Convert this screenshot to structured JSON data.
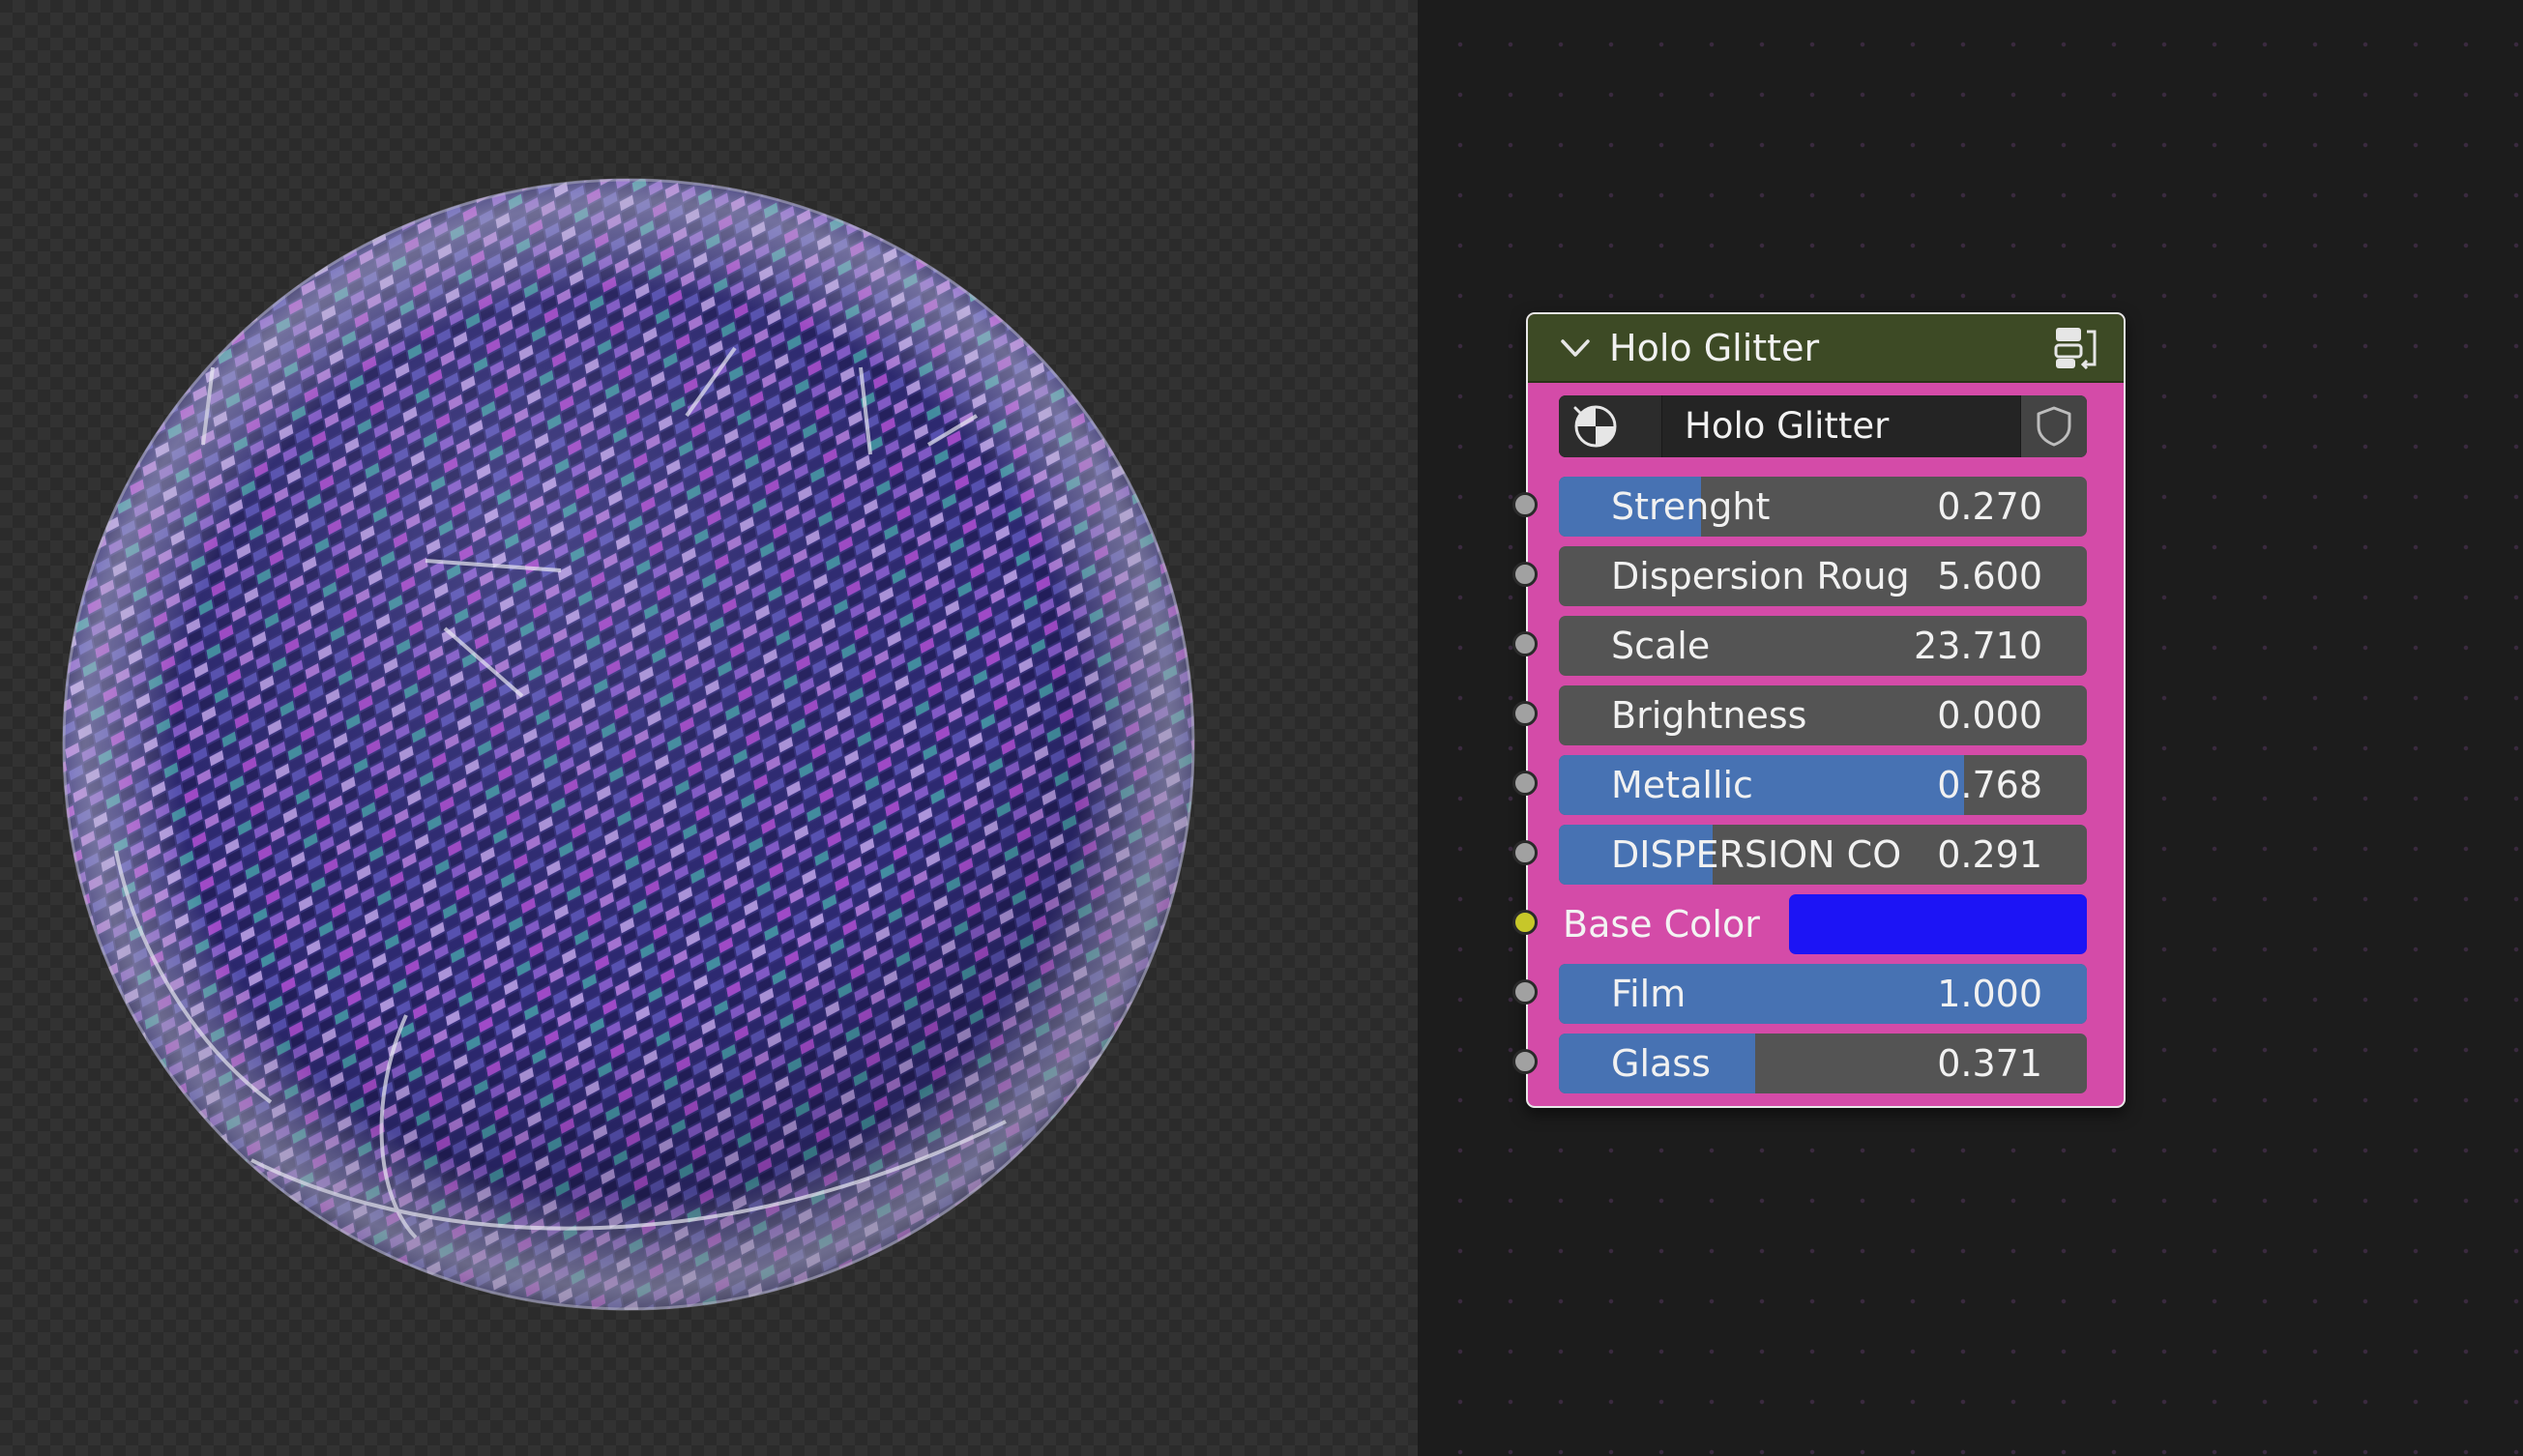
{
  "node": {
    "title": "Holo Glitter",
    "header_color": "#3d4a25",
    "body_color": "#d44ba8",
    "collapse_icon": "chevron-down-icon",
    "group_icon": "node-group-icon",
    "datablock": {
      "type_icon": "node-tree-icon",
      "name": "Holo Glitter",
      "fake_user_icon": "shield-icon"
    },
    "inputs": [
      {
        "label": "Strenght",
        "value": "0.270",
        "fill": 0.27
      },
      {
        "label": "Dispersion Roug",
        "value": "5.600",
        "fill": 0
      },
      {
        "label": "Scale",
        "value": "23.710",
        "fill": 0
      },
      {
        "label": "Brightness",
        "value": "0.000",
        "fill": 0
      },
      {
        "label": "Metallic",
        "value": "0.768",
        "fill": 0.768
      },
      {
        "label": "DISPERSION CO",
        "value": "0.291",
        "fill": 0.291
      }
    ],
    "base_color": {
      "label": "Base Color",
      "color": "#1c14f5"
    },
    "inputs_after": [
      {
        "label": "Film",
        "value": "1.000",
        "fill": 1.0
      },
      {
        "label": "Glass",
        "value": "0.371",
        "fill": 0.371
      }
    ],
    "slider_fill_color": "#4772b3",
    "slider_bg_color": "#545454",
    "socket_color": "#a1a1a1",
    "color_socket_color": "#c7c729"
  },
  "viewport": {
    "preview": "holographic-glitter-sphere"
  }
}
